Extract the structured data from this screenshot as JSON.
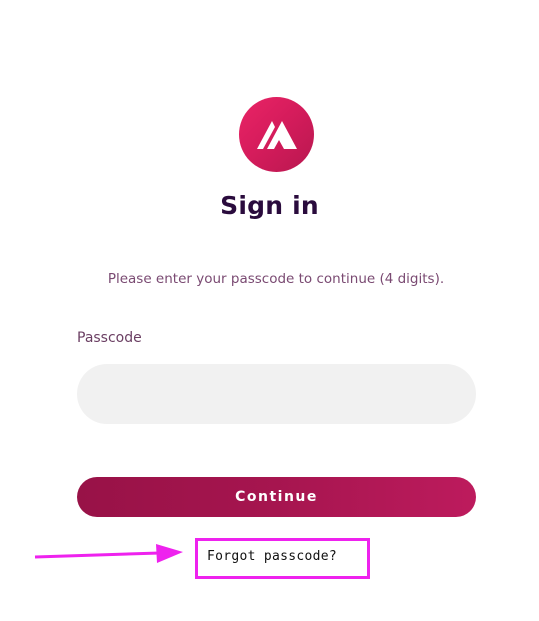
{
  "logo": {
    "icon": "mountain-peaks-icon",
    "colors": [
      "#ea2466",
      "#b8174f"
    ]
  },
  "header": {
    "title": "Sign in"
  },
  "instructions": {
    "text": "Please enter your passcode to continue (4 digits)."
  },
  "passcode": {
    "label": "Passcode",
    "value": "",
    "placeholder": ""
  },
  "actions": {
    "continue_label": "Continue",
    "forgot_label": "Forgot passcode?"
  },
  "annotation": {
    "color": "#ee22ee",
    "type": "arrow-and-highlight-box"
  }
}
